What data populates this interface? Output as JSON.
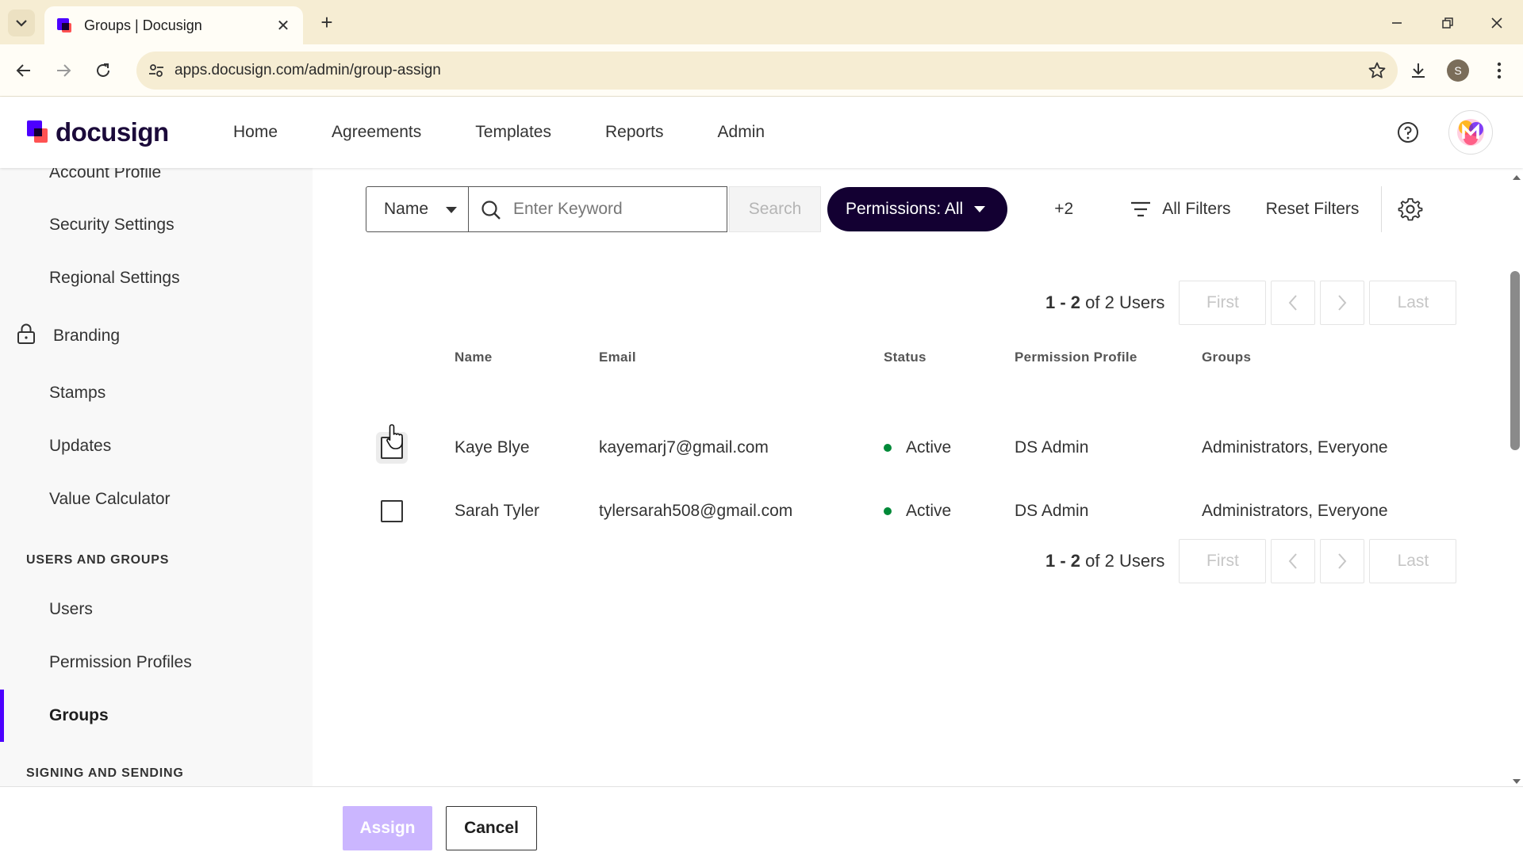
{
  "browser": {
    "tab_title": "Groups | Docusign",
    "url": "apps.docusign.com/admin/group-assign",
    "profile_initial": "S"
  },
  "app": {
    "logo_text": "docusign",
    "brand_color": "#4c00ff",
    "nav": [
      "Home",
      "Agreements",
      "Templates",
      "Reports",
      "Admin"
    ]
  },
  "sidebar": {
    "items_top": [
      "Account Profile",
      "Security Settings",
      "Regional Settings"
    ],
    "branding": "Branding",
    "items_mid": [
      "Stamps",
      "Updates",
      "Value Calculator"
    ],
    "heading_users": "USERS AND GROUPS",
    "items_users": [
      "Users",
      "Permission Profiles",
      "Groups"
    ],
    "heading_signing": "SIGNING AND SENDING",
    "active_item": "Groups"
  },
  "filters": {
    "field_select": "Name",
    "keyword_placeholder": "Enter Keyword",
    "search_label": "Search",
    "permissions_label": "Permissions: All",
    "more_count": "+2",
    "all_filters_label": "All Filters",
    "reset_label": "Reset Filters"
  },
  "pager": {
    "range": "1 - 2",
    "of_text": "of 2 Users",
    "first": "First",
    "last": "Last",
    "prev_icon": "chevron-left-icon",
    "next_icon": "chevron-right-icon"
  },
  "table": {
    "columns": [
      "Name",
      "Email",
      "Status",
      "Permission Profile",
      "Groups"
    ],
    "rows": [
      {
        "name": "Kaye Blye",
        "email": "kayemarj7@gmail.com",
        "status": "Active",
        "profile": "DS Admin",
        "groups": "Administrators, Everyone",
        "checked": false
      },
      {
        "name": "Sarah Tyler",
        "email": "tylersarah508@gmail.com",
        "status": "Active",
        "profile": "DS Admin",
        "groups": "Administrators, Everyone",
        "checked": false
      }
    ],
    "status_color": "#008938"
  },
  "footer": {
    "assign_label": "Assign",
    "cancel_label": "Cancel"
  }
}
